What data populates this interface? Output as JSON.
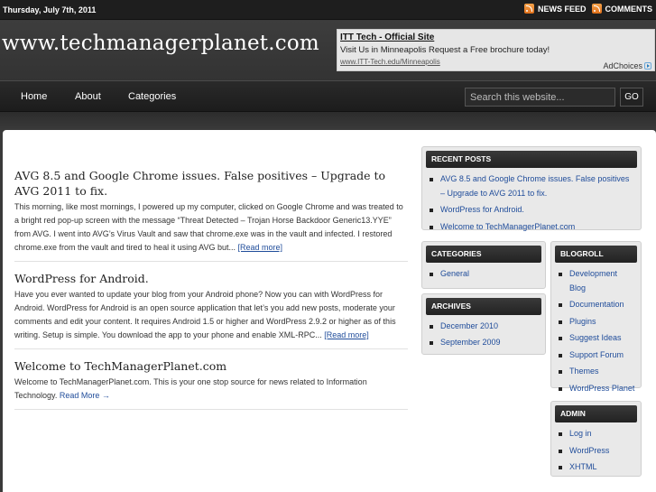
{
  "topbar": {
    "date": "Thursday, July 7th, 2011",
    "news_feed": "NEWS FEED",
    "comments": "COMMENTS",
    "rss_icon": "rss-icon"
  },
  "header": {
    "site_title": "www.techmanagerplanet.com"
  },
  "ad": {
    "title": "ITT Tech - Official Site",
    "text": "Visit Us in Minneapolis Request a Free brochure today!",
    "url": "www.ITT-Tech.edu/Minneapolis",
    "choices": "AdChoices"
  },
  "nav": {
    "items": [
      "Home",
      "About",
      "Categories"
    ],
    "search_placeholder": "Search this website...",
    "go_label": "GO"
  },
  "posts": [
    {
      "title": "AVG 8.5 and Google Chrome issues. False positives – Upgrade to AVG 2011 to fix.",
      "body": "This morning, like most mornings, I powered up my computer, clicked on Google Chrome and was treated to a bright red pop-up screen with the message “Threat Detected – Trojan Horse Backdoor Generic13.YYE” from AVG.   I went into AVG’s Virus Vault and saw that chrome.exe was in the vault and infected.  I restored chrome.exe from the vault and tired to heal it using AVG but... ",
      "more": "[Read more]"
    },
    {
      "title": "WordPress for Android.",
      "body": "Have you ever wanted to update your blog from your Android phone?  Now you can with WordPress for Android. WordPress for Android is an open source application that let’s you add new posts, moderate your comments and edit your content.  It requires Android 1.5 or higher and WordPress 2.9.2 or higher as of this writing. Setup is simple.  You download the app to your phone and enable XML-RPC... ",
      "more": "[Read more]"
    },
    {
      "title": "Welcome to TechManagerPlanet.com",
      "body": "Welcome to TechManagerPlanet.com.  This is your one stop source for news related to Information Technology.  ",
      "more": "Read More →"
    }
  ],
  "sidebar": {
    "recent_posts": {
      "title": "RECENT POSTS",
      "items": [
        "AVG 8.5 and Google Chrome issues. False positives – Upgrade to AVG 2011 to fix.",
        "WordPress for Android.",
        "Welcome to TechManagerPlanet.com"
      ]
    },
    "categories": {
      "title": "CATEGORIES",
      "items": [
        "General"
      ]
    },
    "archives": {
      "title": "ARCHIVES",
      "items": [
        "December 2010",
        "September 2009"
      ]
    },
    "blogroll": {
      "title": "BLOGROLL",
      "items": [
        "Development Blog",
        "Documentation",
        "Plugins",
        "Suggest Ideas",
        "Support Forum",
        "Themes",
        "WordPress Planet"
      ]
    },
    "admin": {
      "title": "ADMIN",
      "items": [
        "Log in",
        "WordPress",
        "XHTML"
      ]
    }
  },
  "colors": {
    "link": "#1f4c9a",
    "dark_bar": "#222222",
    "rss_orange": "#e0701b"
  }
}
